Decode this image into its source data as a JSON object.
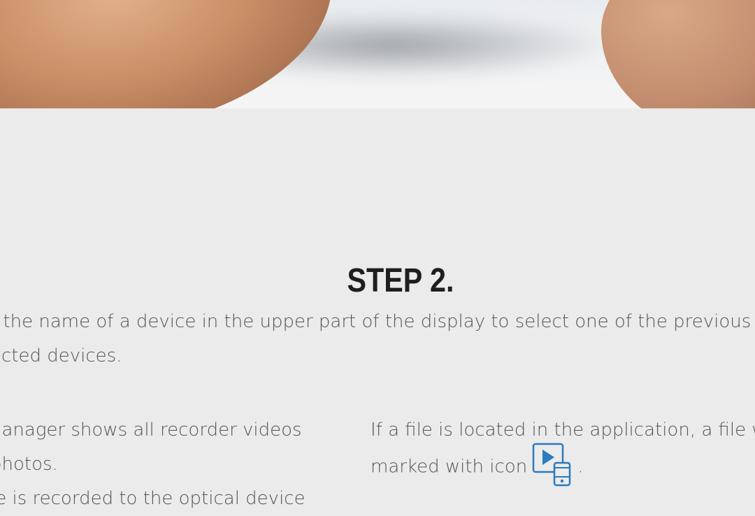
{
  "hero": {
    "image_alt": "blurred photo of a person's arm and face"
  },
  "step": {
    "title": "STEP 2."
  },
  "intro": {
    "lines": [
      "t the name of a device in the upper part of the display to select one of the previous",
      "ected devices."
    ]
  },
  "left_column": {
    "lines": [
      "nanager shows all recorder videos",
      "photos.",
      "le is recorded to the optical device"
    ]
  },
  "right_column": {
    "line1": "If a file is located in the application, a file w",
    "line2_before": "marked with icon",
    "line2_after": ".",
    "icon": "video-on-phone-icon",
    "icon_color": "#2b7bbd"
  },
  "colors": {
    "background": "#ebebeb",
    "title": "#1e1e1e",
    "text": "#555555",
    "accent": "#2b7bbd"
  }
}
